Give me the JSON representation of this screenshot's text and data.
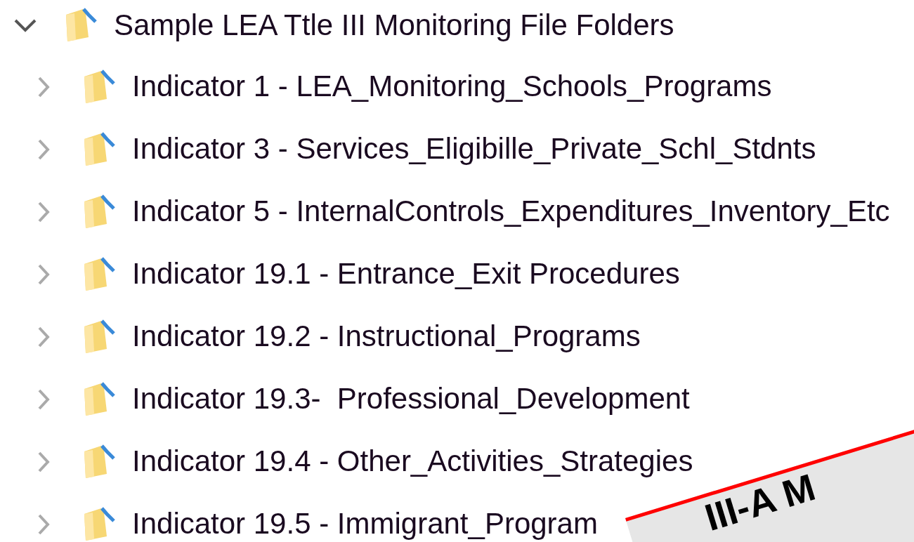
{
  "tree": [
    {
      "label": "Sample LEA Ttle III Monitoring File Folders",
      "expanded": true,
      "children": [
        {
          "label": "Indicator 1 - LEA_Monitoring_Schools_Programs",
          "expanded": false
        },
        {
          "label": "Indicator 3 - Services_Eligibille_Private_Schl_Stdnts",
          "expanded": false
        },
        {
          "label": "Indicator 5 - InternalControls_Expenditures_Inventory_Etc",
          "expanded": false
        },
        {
          "label": "Indicator 19.1 - Entrance_Exit Procedures",
          "expanded": false
        },
        {
          "label": "Indicator 19.2 - Instructional_Programs",
          "expanded": false
        },
        {
          "label": "Indicator 19.3-  Professional_Development",
          "expanded": false
        },
        {
          "label": "Indicator 19.4 - Other_Activities_Strategies",
          "expanded": false
        },
        {
          "label": "Indicator 19.5 - Immigrant_Program",
          "expanded": false
        }
      ]
    }
  ],
  "banner": {
    "text": "III-A M"
  }
}
